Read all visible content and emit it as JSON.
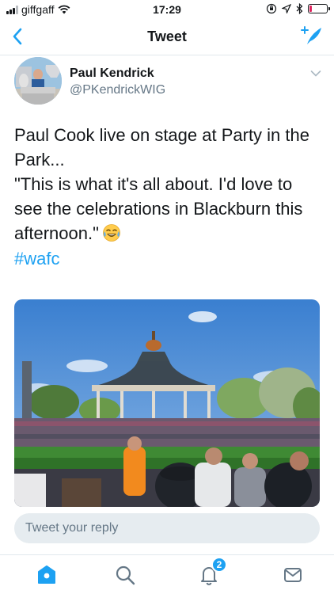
{
  "status_bar": {
    "carrier": "giffgaff",
    "time": "17:29",
    "battery_level": 0.12
  },
  "nav": {
    "title": "Tweet"
  },
  "tweet": {
    "author_name": "Paul Kendrick",
    "author_handle": "@PKendrickWIG",
    "text_line1": "Paul Cook live on stage at Party in the Park...",
    "text_line2": "\"This is what it's all about. I'd love to see the celebrations in Blackburn this afternoon.\"",
    "hashtag": "#wafc"
  },
  "reply": {
    "placeholder": "Tweet your reply"
  },
  "tab_bar": {
    "notification_count": "2",
    "active_tab": "home"
  },
  "colors": {
    "accent": "#1da1f2",
    "text": "#14171a",
    "secondary": "#657786"
  }
}
